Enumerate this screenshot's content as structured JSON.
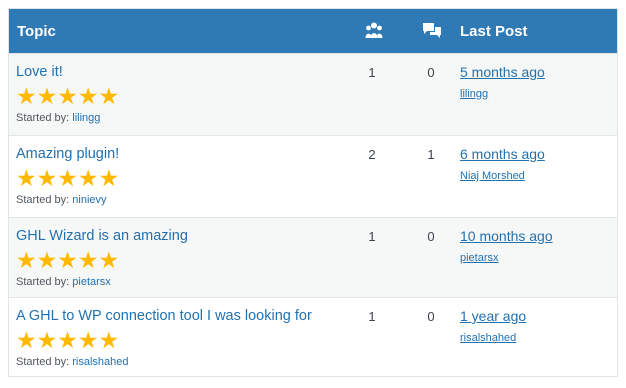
{
  "header": {
    "topic_label": "Topic",
    "voices_icon": "participants-icon",
    "replies_icon": "speech-bubbles-icon",
    "last_post_label": "Last Post"
  },
  "topics": [
    {
      "title": "Love it!",
      "rating": 5,
      "started_by_label": "Started by:",
      "author": "lilingg",
      "voices": "1",
      "replies": "0",
      "last_post_time": "5 months ago",
      "last_post_user": "lilingg"
    },
    {
      "title": "Amazing plugin!",
      "rating": 5,
      "started_by_label": "Started by:",
      "author": "ninievy",
      "voices": "2",
      "replies": "1",
      "last_post_time": "6 months ago",
      "last_post_user": "Niaj Morshed"
    },
    {
      "title": "GHL Wizard is an amazing",
      "rating": 5,
      "started_by_label": "Started by:",
      "author": "pietarsx",
      "voices": "1",
      "replies": "0",
      "last_post_time": "10 months ago",
      "last_post_user": "pietarsx"
    },
    {
      "title": "A GHL to WP connection tool I was looking for",
      "rating": 5,
      "started_by_label": "Started by:",
      "author": "risalshahed",
      "voices": "1",
      "replies": "0",
      "last_post_time": "1 year ago",
      "last_post_user": "risalshahed"
    }
  ],
  "colors": {
    "header_bg": "#2f79b5",
    "link": "#2271b1",
    "star": "#ffb900"
  }
}
